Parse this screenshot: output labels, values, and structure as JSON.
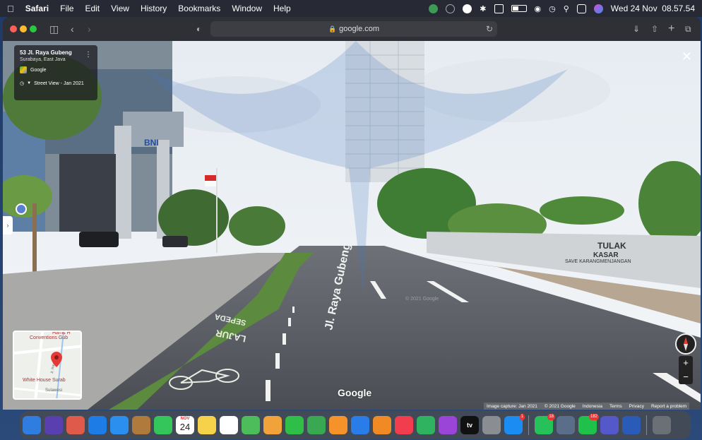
{
  "menubar": {
    "app": "Safari",
    "items": [
      "File",
      "Edit",
      "View",
      "History",
      "Bookmarks",
      "Window",
      "Help"
    ],
    "datetime": "Wed 24 Nov  08.57.54"
  },
  "browser": {
    "address": "google.com"
  },
  "streetview": {
    "place_title": "53 Jl. Raya Gubeng",
    "place_subtitle": "Surabaya, East Java",
    "provider": "Google",
    "date_label": "Street View - Jan 2021",
    "road_label": "Jl. Raya Gubeng",
    "lane_text_1": "LAJUR",
    "lane_text_2": "SEPEDA",
    "bank_sign": "BNI",
    "graffiti_1": "TULAK",
    "graffiti_2": "KASAR",
    "graffiti_3": "SAVE KARANGMENJANGAN",
    "watermark": "Google",
    "image_copyright": "© 2021 Google",
    "footer": [
      "Image capture: Jan 2021",
      "© 2021 Google",
      "Indonesia",
      "Terms",
      "Privacy",
      "Report a problem"
    ],
    "zoom_in": "+",
    "zoom_out": "−"
  },
  "minimap": {
    "labels": [
      "Harris H",
      "Conventions Gub",
      "Jl. Raya Gub",
      "White House Surab",
      "Sulawesi"
    ]
  },
  "dock": {
    "calendar_month": "NOV",
    "calendar_day": "24",
    "tv_label": "tv",
    "badges": {
      "appstore": "1",
      "whatsapp": "18",
      "line": "182"
    },
    "apps": [
      {
        "name": "finder",
        "color": "#2f7de1"
      },
      {
        "name": "siri",
        "color": "#5a3fb0"
      },
      {
        "name": "launchpad",
        "color": "#e05a4c"
      },
      {
        "name": "safari",
        "color": "#1e7ce6"
      },
      {
        "name": "mail",
        "color": "#2b8ff0"
      },
      {
        "name": "contacts",
        "color": "#b07a3c"
      },
      {
        "name": "messages",
        "color": "#34c65a"
      },
      {
        "name": "calendar",
        "color": "#ffffff"
      },
      {
        "name": "notes",
        "color": "#f6d24a"
      },
      {
        "name": "reminders",
        "color": "#ffffff"
      },
      {
        "name": "maps",
        "color": "#4dbd5c"
      },
      {
        "name": "photos",
        "color": "#f2a23b"
      },
      {
        "name": "facetime",
        "color": "#2fbf48"
      },
      {
        "name": "numbers",
        "color": "#38a852"
      },
      {
        "name": "pages",
        "color": "#f5932a"
      },
      {
        "name": "keynote",
        "color": "#2a7de8"
      },
      {
        "name": "books",
        "color": "#f08a24"
      },
      {
        "name": "music",
        "color": "#f23d4f"
      },
      {
        "name": "find-my",
        "color": "#2fb360"
      },
      {
        "name": "podcasts",
        "color": "#9a45d8"
      },
      {
        "name": "apple-tv",
        "color": "#111111"
      },
      {
        "name": "system-preferences",
        "color": "#8a8d92"
      },
      {
        "name": "app-store",
        "color": "#1b8cf2"
      },
      {
        "name": "whatsapp",
        "color": "#27c15a"
      },
      {
        "name": "preview",
        "color": "#5a6e8a"
      },
      {
        "name": "line",
        "color": "#1fc14a"
      },
      {
        "name": "teams",
        "color": "#5558c9"
      },
      {
        "name": "word",
        "color": "#2b5bb8"
      },
      {
        "name": "trash",
        "color": "#6b6f76"
      }
    ]
  }
}
